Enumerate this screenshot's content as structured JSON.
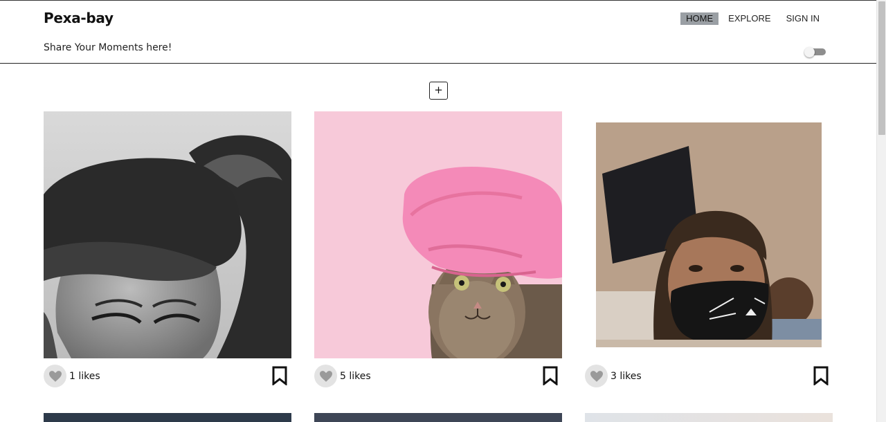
{
  "header": {
    "brand": "Pexa-bay",
    "tagline": "Share Your Moments here!"
  },
  "nav": {
    "items": [
      {
        "label": "HOME",
        "active": true
      },
      {
        "label": "EXPLORE",
        "active": false
      },
      {
        "label": "SIGN IN",
        "active": false
      }
    ]
  },
  "theme_toggle": {
    "on": false
  },
  "add_button": {
    "label": "+"
  },
  "posts": [
    {
      "likes": "1 likes",
      "image": "black-and-white couple photo"
    },
    {
      "likes": "5 likes",
      "image": "cat wearing pink shower cap"
    },
    {
      "likes": "3 likes",
      "image": "girl wearing black cat-face mask"
    }
  ],
  "icons": {
    "like": "heart-icon",
    "save": "bookmark-icon"
  },
  "colors": {
    "active_nav_bg": "#9a9fa4",
    "like_circle": "#e3e3e3",
    "heart": "#9a9a9a"
  }
}
